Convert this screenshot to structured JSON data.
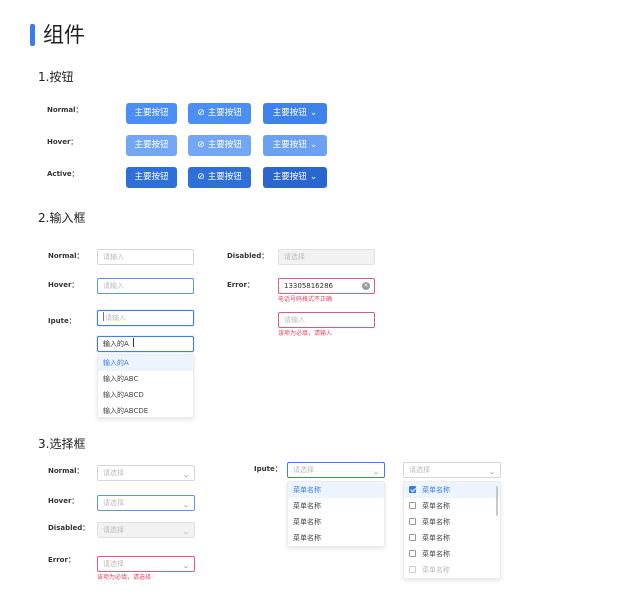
{
  "page": {
    "title": "组件"
  },
  "buttons": {
    "section_title": "1.按钮",
    "rows": [
      {
        "label": "Normal：",
        "primary": "主要按钮",
        "icon_btn": "主要按钮",
        "split": "主要按钮"
      },
      {
        "label": "Hover：",
        "primary": "主要按钮",
        "icon_btn": "主要按钮",
        "split": "主要按钮"
      },
      {
        "label": "Active：",
        "primary": "主要按钮",
        "icon_btn": "主要按钮",
        "split": "主要按钮"
      }
    ]
  },
  "inputs": {
    "section_title": "2.输入框",
    "normal": {
      "label": "Normal：",
      "placeholder": "请输入"
    },
    "hover": {
      "label": "Hover：",
      "placeholder": "请输入"
    },
    "input": {
      "label": "Ipute：",
      "placeholder": "请输入"
    },
    "autocomplete": {
      "value": "输入的A",
      "options": [
        "输入的A",
        "输入的ABC",
        "输入的ABCD",
        "输入的ABCDE"
      ]
    },
    "disabled": {
      "label": "Disabled：",
      "placeholder": "请选择"
    },
    "error": {
      "label": "Error：",
      "value": "13305816286",
      "message": "电话号码格式不正确"
    },
    "required": {
      "placeholder": "请输入",
      "message": "该项为必填，请输入"
    }
  },
  "selects": {
    "section_title": "3.选择框",
    "normal": {
      "label": "Normal：",
      "placeholder": "请选择"
    },
    "hover": {
      "label": "Hover：",
      "placeholder": "请选择"
    },
    "disabled": {
      "label": "Disabled：",
      "placeholder": "请选择"
    },
    "error": {
      "label": "Error：",
      "placeholder": "请选择",
      "message": "该项为必填，请选择"
    },
    "open": {
      "label": "Ipute：",
      "placeholder": "请选择",
      "options": [
        "菜单名称",
        "菜单名称",
        "菜单名称",
        "菜单名称"
      ]
    },
    "multi": {
      "placeholder": "请选择",
      "options": [
        "菜单名称",
        "菜单名称",
        "菜单名称",
        "菜单名称",
        "菜单名称",
        "菜单名称"
      ],
      "checked": [
        true,
        false,
        false,
        false,
        false,
        false
      ]
    }
  },
  "colors": {
    "accent": "#3b7cf0",
    "error": "#e0445f"
  }
}
